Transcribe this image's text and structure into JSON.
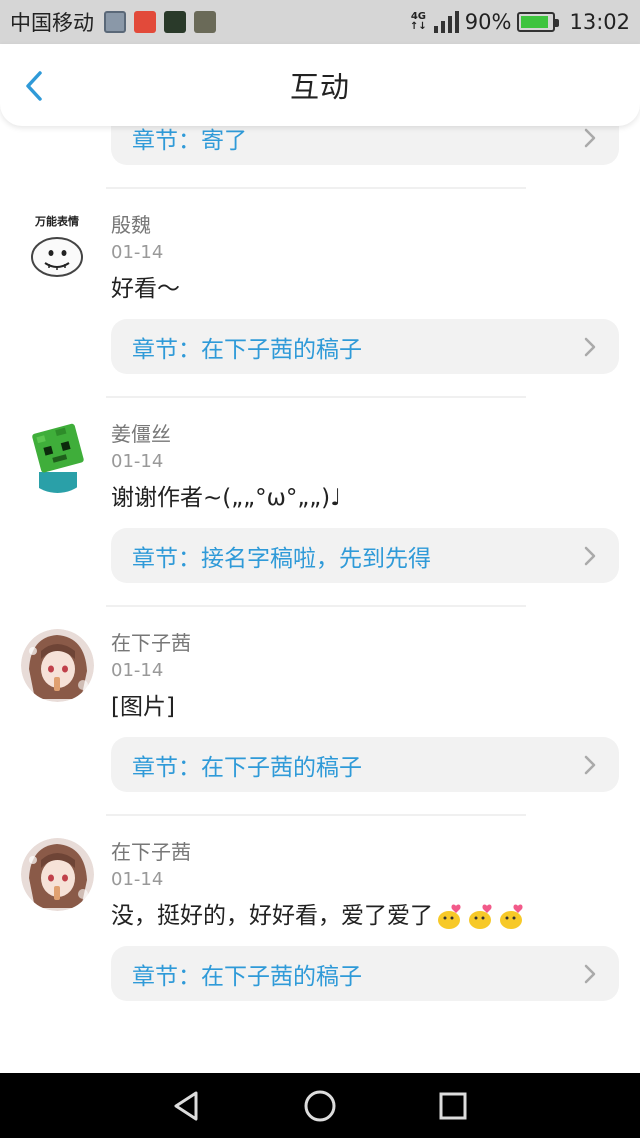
{
  "status_bar": {
    "carrier": "中国移动",
    "network": "4G",
    "battery": "90%",
    "battery_level": 0.9,
    "time": "13:02",
    "notification_icons": [
      "gallery-icon",
      "app-icon-red",
      "app-icon-reverse",
      "app-icon-game"
    ]
  },
  "header": {
    "title": "互动",
    "back_icon": "chevron-left-icon"
  },
  "colors": {
    "accent": "#2f9ad8",
    "card_bg": "#f2f2f2",
    "battery": "#3ec43e"
  },
  "top_card": {
    "chapter": "章节：寄了"
  },
  "comments": [
    {
      "username": "殷魏",
      "date": "01-14",
      "text": "好看～",
      "chapter": "章节：在下子茜的稿子",
      "avatar": "meme-face-avatar",
      "avatar_caption": "万能表情"
    },
    {
      "username": "姜僵丝",
      "date": "01-14",
      "text": "谢谢作者~(„„°ω°„„)♩",
      "chapter": "章节：接名字稿啦，先到先得",
      "avatar": "green-zombie-avatar"
    },
    {
      "username": "在下子茜",
      "date": "01-14",
      "text": "[图片]",
      "chapter": "章节：在下子茜的稿子",
      "avatar": "anime-girl-avatar"
    },
    {
      "username": "在下子茜",
      "date": "01-14",
      "text": "没，挺好的，好好看，爱了爱了",
      "text_emoji": [
        "chick-heart-emoji",
        "chick-heart-emoji",
        "chick-heart-emoji"
      ],
      "chapter": "章节：在下子茜的稿子",
      "avatar": "anime-girl-avatar"
    }
  ],
  "nav_bar": {
    "back": "triangle-back-icon",
    "home": "circle-home-icon",
    "recents": "square-recents-icon"
  }
}
